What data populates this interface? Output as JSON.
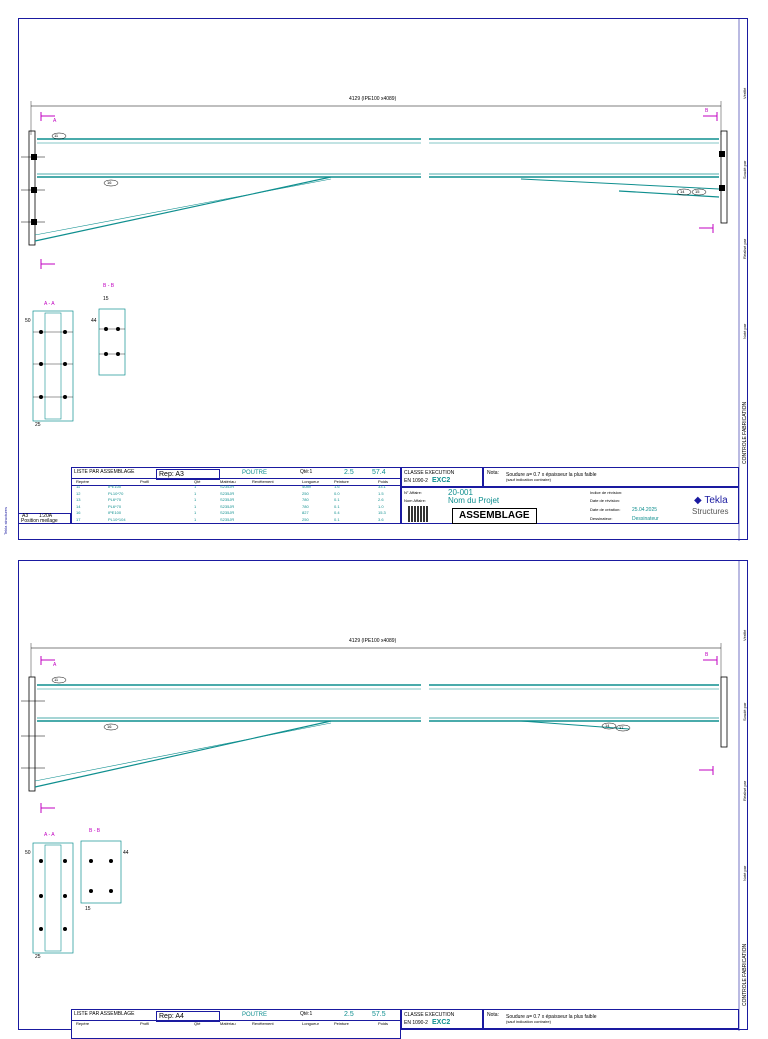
{
  "sheets": [
    {
      "dimension": "4129 (IPE100 x4089)",
      "section_a": "A - A",
      "section_b": "B - B",
      "section_letter_a": "A",
      "section_letter_b": "B",
      "dim_50": "50",
      "dim_44": "44",
      "dim_15": "15",
      "dim_25": "25",
      "bubble_11": "11",
      "bubble_16": "16",
      "bubble_14": "14",
      "bubble_15": "15",
      "bubble_17": "17",
      "list_title": "LISTE PAR ASSEMBLAGE",
      "rep": "Rep: A3",
      "type": "POUTRE",
      "qte": "Qté:1",
      "surface": "2.5",
      "weight": "57.4",
      "headers": [
        "Repère",
        "Profil",
        "Qté",
        "Matériau",
        "Revêtement",
        "Longueur",
        "Peinture",
        "Poids"
      ],
      "rows": [
        [
          "11",
          "IPE100",
          "1",
          "S235JR",
          "",
          "4089",
          "1.6",
          "33.1"
        ],
        [
          "12",
          "PL10*70",
          "1",
          "S235JR",
          "",
          "250",
          "0.0",
          "1.5"
        ],
        [
          "13",
          "PL6*70",
          "1",
          "S235JR",
          "",
          "780",
          "0.1",
          "2.6"
        ],
        [
          "14",
          "PL6*70",
          "1",
          "S235JR",
          "",
          "780",
          "0.1",
          "1.0"
        ],
        [
          "16",
          "IPE100",
          "1",
          "S235JR",
          "",
          "827",
          "0.4",
          "15.3"
        ],
        [
          "17",
          "PL10*104",
          "1",
          "S235JR",
          "",
          "250",
          "0.1",
          "3.6"
        ]
      ],
      "classe": "CLASSE EXECUTION",
      "norm": "EN 1090-2",
      "exc": "EXC2",
      "nota_label": "Nota:",
      "nota": "Soudure a= 0.7 x épaisseur la plus faible",
      "nota_sub": "(sauf indication contraire)",
      "affaire_label": "N° Affaire:",
      "affaire": "20-001",
      "nom_label": "Nom Affaire:",
      "nom": "Nom du Projet",
      "assemblage": "ASSEMBLAGE",
      "indice": "Indice de révision:",
      "date_rev": "Date de révision:",
      "date_crea": "Date de création:",
      "date_crea_val": "25.04.2025",
      "dessinateur_label": "Dessinateur:",
      "dessinateur": "Dessinateur",
      "a3": "A3",
      "scale": "1:20A",
      "position": "Position meilage",
      "side_labels": [
        "Vérifié",
        "Soudé par",
        "Réalisé par",
        "Noté par",
        "CONTROLE FABRICATION"
      ]
    },
    {
      "dimension": "4129 (IPE100 x4089)",
      "section_a": "A - A",
      "section_b": "B - B",
      "section_letter_a": "A",
      "section_letter_b": "B",
      "dim_50": "50",
      "dim_44": "44",
      "dim_15": "15",
      "dim_25": "25",
      "bubble_11": "11",
      "bubble_16": "16",
      "bubble_14": "14",
      "bubble_15": "15",
      "bubble_17": "17",
      "list_title": "LISTE PAR ASSEMBLAGE",
      "rep": "Rep: A4",
      "type": "POUTRE",
      "qte": "Qté:1",
      "surface": "2.5",
      "weight": "57.5",
      "headers": [
        "Repère",
        "Profil",
        "Qté",
        "Matériau",
        "Revêtement",
        "Longueur",
        "Peinture",
        "Poids"
      ],
      "rows": [],
      "classe": "CLASSE EXECUTION",
      "norm": "EN 1090-2",
      "exc": "EXC2",
      "nota_label": "Nota:",
      "nota": "Soudure a= 0.7 x épaisseur la plus faible",
      "nota_sub": "(sauf indication contraire)",
      "affaire_label": "",
      "affaire": "",
      "nom_label": "",
      "nom": "",
      "assemblage": "",
      "indice": "",
      "date_rev": "",
      "date_crea": "",
      "date_crea_val": "",
      "dessinateur_label": "",
      "dessinateur": "",
      "a3": "",
      "scale": "",
      "position": "",
      "side_labels": [
        "Vérifié",
        "Soudé par",
        "Réalisé par",
        "Noté par",
        "CONTROLE FABRICATION"
      ]
    }
  ],
  "brand": {
    "name": "Tekla",
    "sub": "Structures"
  },
  "left_note": "Tekla structures",
  "colors": {
    "beam": "#0f8f8f",
    "magenta": "#c000c0",
    "frame": "#1a1aa0"
  }
}
